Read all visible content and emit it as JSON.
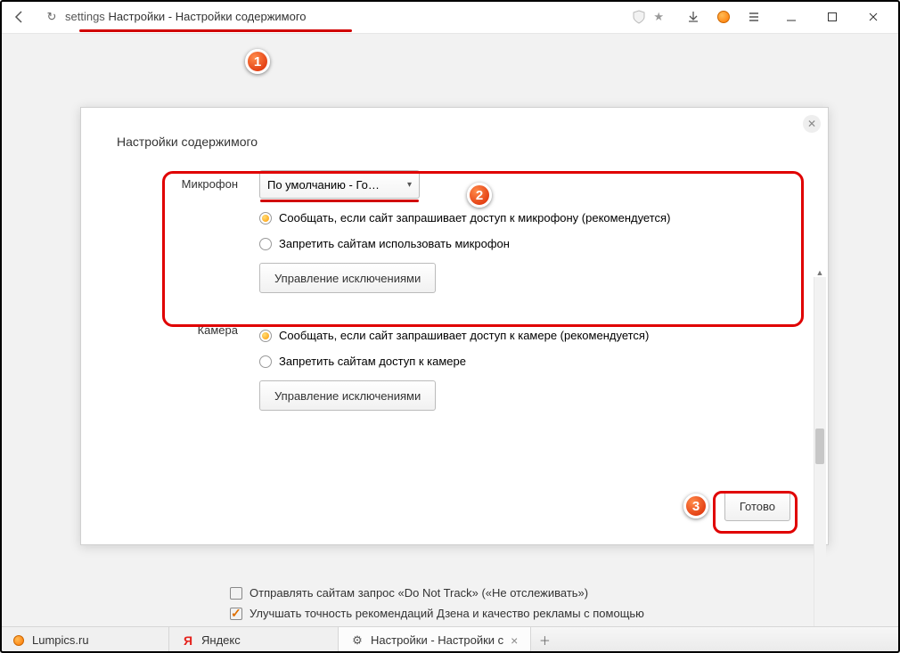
{
  "addressbar": {
    "prefix": "settings",
    "title": "Настройки - Настройки содержимого"
  },
  "dialog": {
    "title": "Настройки содержимого",
    "mic": {
      "label": "Микрофон",
      "device": "По умолчанию - Го…",
      "opt_ask": "Сообщать, если сайт запрашивает доступ к микрофону (рекомендуется)",
      "opt_block": "Запретить сайтам использовать микрофон",
      "exceptions": "Управление исключениями"
    },
    "cam": {
      "label": "Камера",
      "opt_ask": "Сообщать, если сайт запрашивает доступ к камере (рекомендуется)",
      "opt_block": "Запретить сайтам доступ к камере",
      "exceptions": "Управление исключениями"
    },
    "done": "Готово"
  },
  "bg": {
    "dnt": "Отправлять сайтам запрос «Do Not Track» («Не отслеживать»)",
    "zen": "Улучшать точность рекомендаций Дзена и качество рекламы с помощью"
  },
  "tabs": {
    "t1": "Lumpics.ru",
    "t2": "Яндекс",
    "t3": "Настройки - Настройки с"
  },
  "badges": {
    "n1": "1",
    "n2": "2",
    "n3": "3"
  }
}
